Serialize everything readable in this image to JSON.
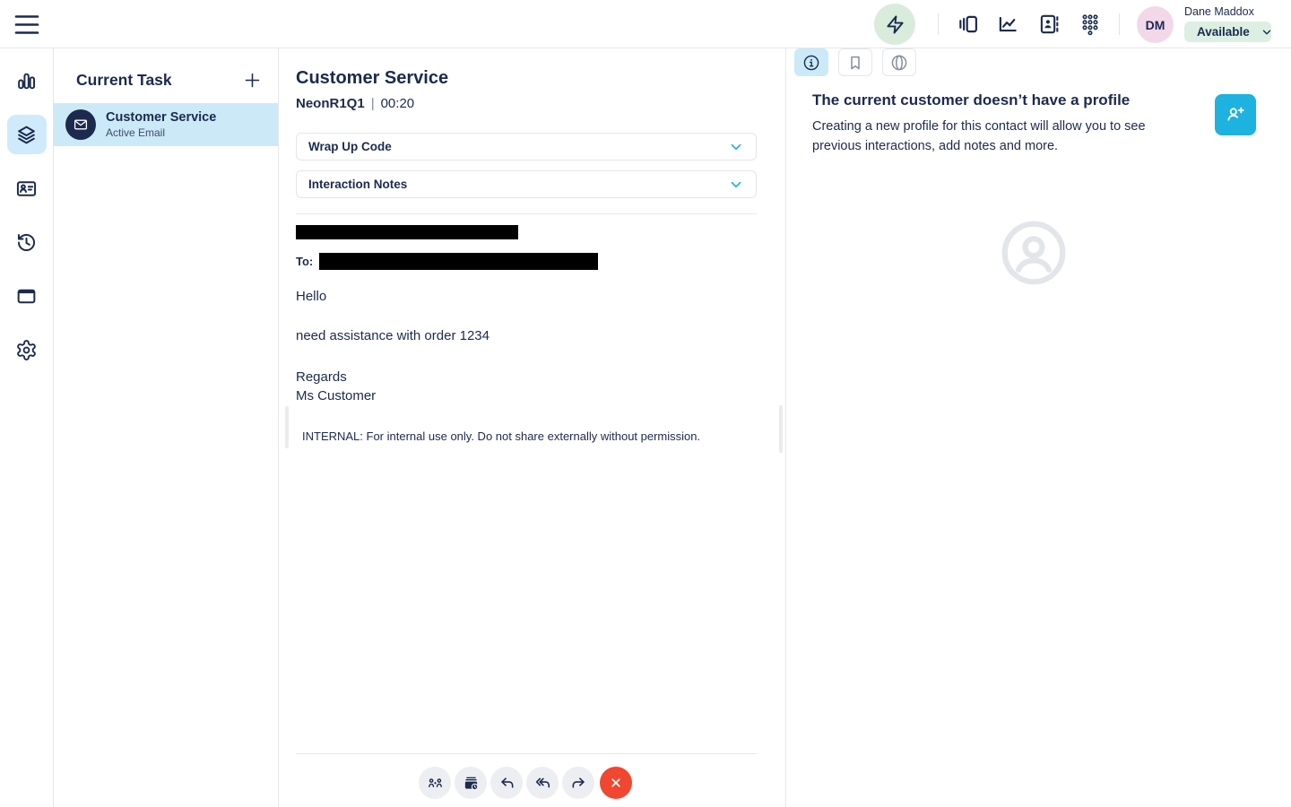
{
  "header": {
    "user_name": "Dane Maddox",
    "user_initials": "DM",
    "status": "Available",
    "icons": [
      "hamburger-icon",
      "quick-actions-icon",
      "interactions-icon",
      "performance-icon",
      "directory-icon",
      "dialpad-icon"
    ]
  },
  "rail_icons": [
    "bar-chart-icon",
    "layers-icon",
    "contact-card-icon",
    "history-icon",
    "window-icon",
    "gear-icon"
  ],
  "task_panel": {
    "title": "Current Task",
    "items": [
      {
        "title": "Customer Service",
        "subtitle": "Active Email",
        "icon": "email-icon"
      }
    ]
  },
  "interaction": {
    "title": "Customer Service",
    "queue": "NeonR1Q1",
    "separator": "|",
    "timer": "00:20",
    "wrap_up_label": "Wrap Up Code",
    "notes_label": "Interaction Notes",
    "email": {
      "to_label": "To:",
      "greeting": "Hello",
      "body": "need assistance with order 1234",
      "closing": "Regards",
      "signature": "Ms Customer",
      "internal_note": "INTERNAL: For internal use only. Do not share externally without permission."
    },
    "toolbar_icons": [
      "transfer-icon",
      "park-email-icon",
      "reply-icon",
      "reply-all-icon",
      "forward-icon",
      "disconnect-icon"
    ]
  },
  "profile_panel": {
    "tabs": [
      "info-icon",
      "bookmark-icon",
      "journey-icon"
    ],
    "heading": "The current customer doesn’t have a profile",
    "description": "Creating a new profile for this contact will allow you to see previous interactions, add notes and more."
  },
  "colors": {
    "navy": "#1b2a4e",
    "highlight_blue": "#cce9f8",
    "accent_cyan": "#1db2e0",
    "danger_red": "#f1462f",
    "status_green_bg": "#ddefe3",
    "quick_action_green": "#d9ecdc",
    "avatar_pink": "#f3d8e9"
  }
}
